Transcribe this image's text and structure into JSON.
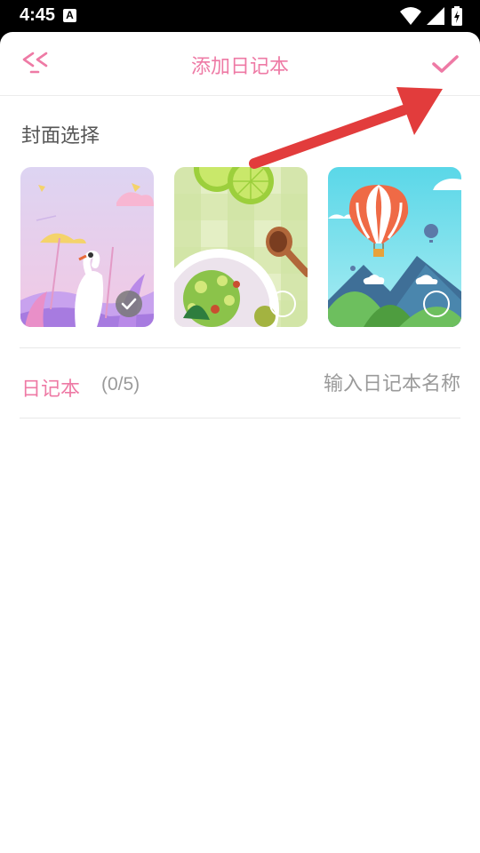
{
  "status_bar": {
    "time": "4:45",
    "notification_icon": "A",
    "icons": [
      "wifi-icon",
      "signal-icon",
      "battery-charging-icon"
    ]
  },
  "header": {
    "title": "添加日记本",
    "back_icon": "back-double-chevron-icon",
    "confirm_icon": "check-icon"
  },
  "cover_section": {
    "label": "封面选择",
    "covers": [
      {
        "name": "swan-lake-cover",
        "selected": true
      },
      {
        "name": "lime-salad-cover",
        "selected": false
      },
      {
        "name": "hot-air-balloon-cover",
        "selected": false
      }
    ]
  },
  "name_field": {
    "label": "日记本",
    "count": "(0/5)",
    "value": "",
    "placeholder": "输入日记本名称"
  },
  "annotation": {
    "arrow_color": "#e23c3c"
  },
  "colors": {
    "accent": "#ee7aa5",
    "text_secondary": "#9a9a9a",
    "divider": "#e8e8e8"
  }
}
